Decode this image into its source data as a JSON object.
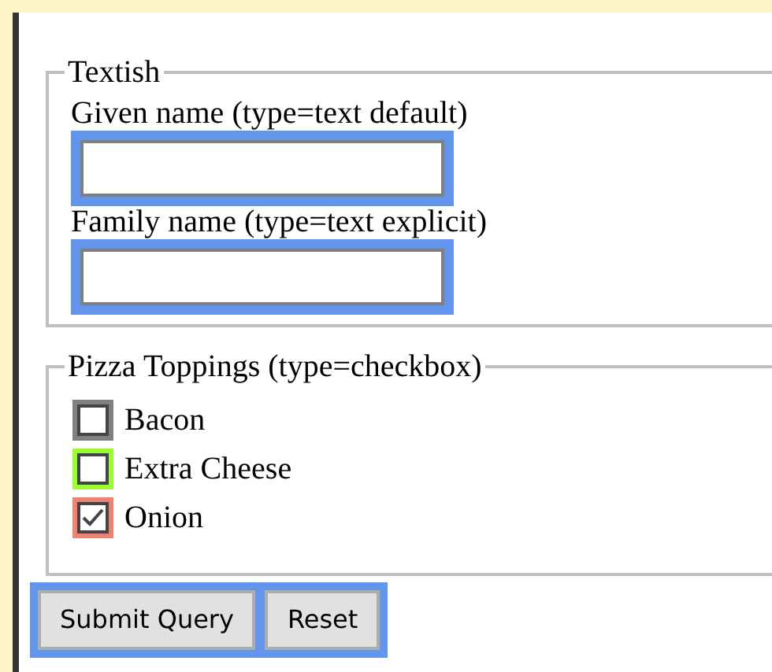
{
  "textish": {
    "legend": "Textish",
    "fields": [
      {
        "label": "Given name (type=text default)",
        "highlighted": true
      },
      {
        "label": "Family name (type=text explicit)",
        "highlighted": true
      }
    ]
  },
  "toppings": {
    "legend": "Pizza Toppings (type=checkbox)",
    "items": [
      {
        "label": "Bacon",
        "checked": false,
        "color": "#808080"
      },
      {
        "label": "Extra Cheese",
        "checked": false,
        "color": "#99ff33"
      },
      {
        "label": "Onion",
        "checked": true,
        "color": "#f08070"
      }
    ]
  },
  "buttons": [
    {
      "label": "Submit Query"
    },
    {
      "label": "Reset"
    }
  ]
}
